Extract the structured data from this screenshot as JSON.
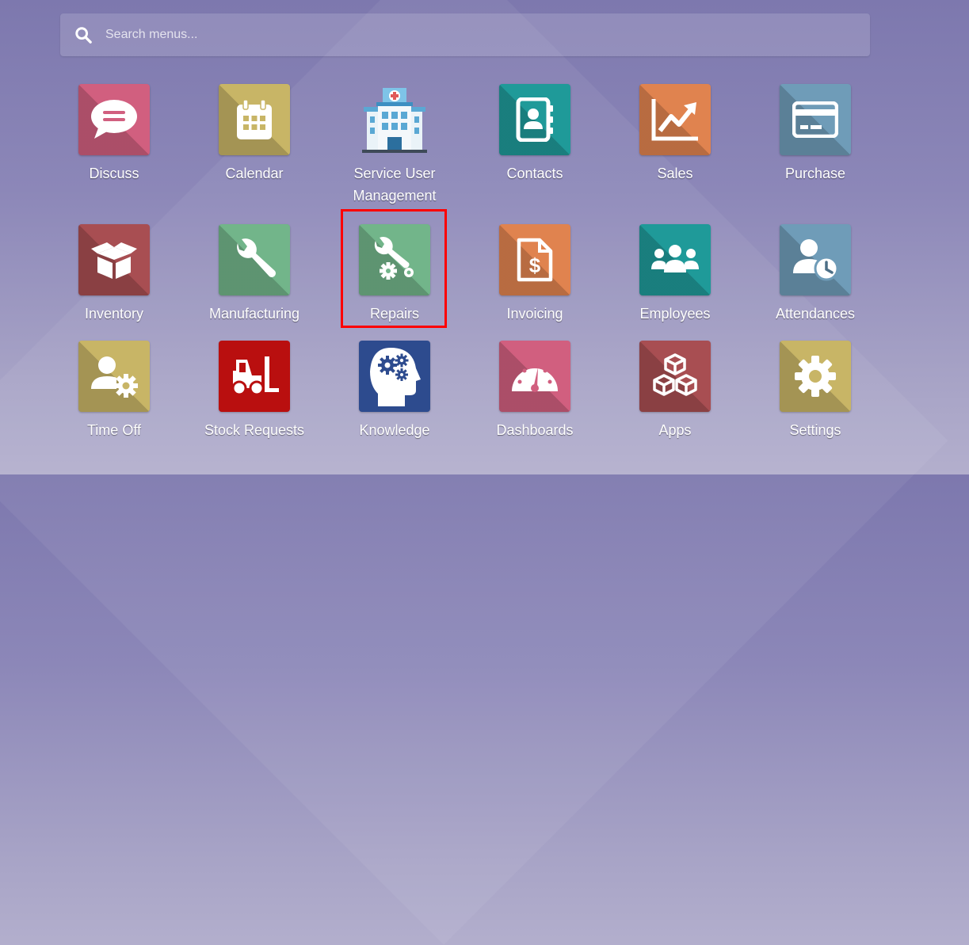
{
  "search": {
    "placeholder": "Search menus..."
  },
  "apps": [
    {
      "label": "Discuss",
      "color": "#d15f7f"
    },
    {
      "label": "Calendar",
      "color": "#c8b566"
    },
    {
      "label": "Service User Management",
      "color": "transparent"
    },
    {
      "label": "Contacts",
      "color": "#1f9a99"
    },
    {
      "label": "Sales",
      "color": "#e0834f"
    },
    {
      "label": "Purchase",
      "color": "#6f9cb8"
    },
    {
      "label": "Inventory",
      "color": "#a84e52"
    },
    {
      "label": "Manufacturing",
      "color": "#72b58a"
    },
    {
      "label": "Repairs",
      "color": "#72b58a"
    },
    {
      "label": "Invoicing",
      "color": "#e0834f"
    },
    {
      "label": "Employees",
      "color": "#1f9a99"
    },
    {
      "label": "Attendances",
      "color": "#6f9cb8"
    },
    {
      "label": "Time Off",
      "color": "#c8b566"
    },
    {
      "label": "Stock Requests",
      "color": "#b90f0f"
    },
    {
      "label": "Knowledge",
      "color": "#2d4b8e"
    },
    {
      "label": "Dashboards",
      "color": "#d15f7f"
    },
    {
      "label": "Apps",
      "color": "#a84e52"
    },
    {
      "label": "Settings",
      "color": "#c8b566"
    }
  ],
  "highlight_color": "#ff0000"
}
